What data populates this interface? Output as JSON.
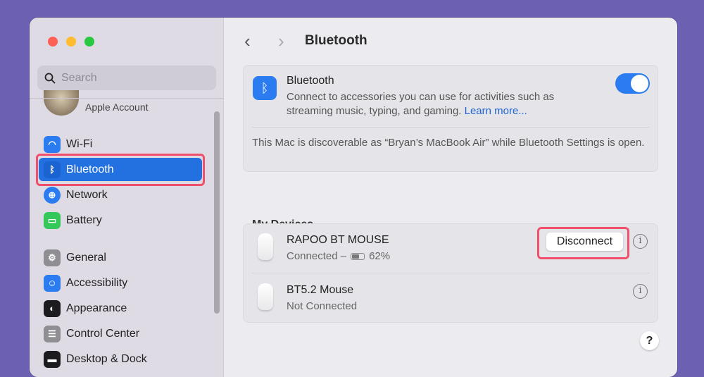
{
  "sidebar": {
    "search_placeholder": "Search",
    "account_label": "Apple Account",
    "items": [
      {
        "label": "Wi-Fi",
        "icon": "wifi-icon",
        "color": "#2b7cf0"
      },
      {
        "label": "Bluetooth",
        "icon": "bluetooth-icon",
        "color": "#2b7cf0",
        "selected": true
      },
      {
        "label": "Network",
        "icon": "globe-icon",
        "color": "#2b7cf0"
      },
      {
        "label": "Battery",
        "icon": "battery-icon",
        "color": "#34c759"
      },
      {
        "label": "General",
        "icon": "gear-icon",
        "color": "#8e8e93"
      },
      {
        "label": "Accessibility",
        "icon": "accessibility-icon",
        "color": "#2b7cf0"
      },
      {
        "label": "Appearance",
        "icon": "appearance-icon",
        "color": "#1c1c1e"
      },
      {
        "label": "Control Center",
        "icon": "control-center-icon",
        "color": "#8e8e93"
      },
      {
        "label": "Desktop & Dock",
        "icon": "dock-icon",
        "color": "#1c1c1e"
      }
    ]
  },
  "header": {
    "title": "Bluetooth",
    "back": "‹",
    "forward": "›"
  },
  "bluetooth_card": {
    "title": "Bluetooth",
    "description": "Connect to accessories you can use for activities such as streaming music, typing, and gaming.",
    "learn_more": "Learn more...",
    "enabled": true,
    "discoverable_text": "This Mac is discoverable as “Bryan’s MacBook Air” while Bluetooth Settings is open."
  },
  "devices": {
    "heading": "My Devices",
    "list": [
      {
        "name": "RAPOO BT MOUSE",
        "status": "Connected –",
        "battery": "62%",
        "battery_level": 0.62,
        "action": "Disconnect"
      },
      {
        "name": "BT5.2 Mouse",
        "status": "Not Connected"
      }
    ]
  },
  "help": "?"
}
